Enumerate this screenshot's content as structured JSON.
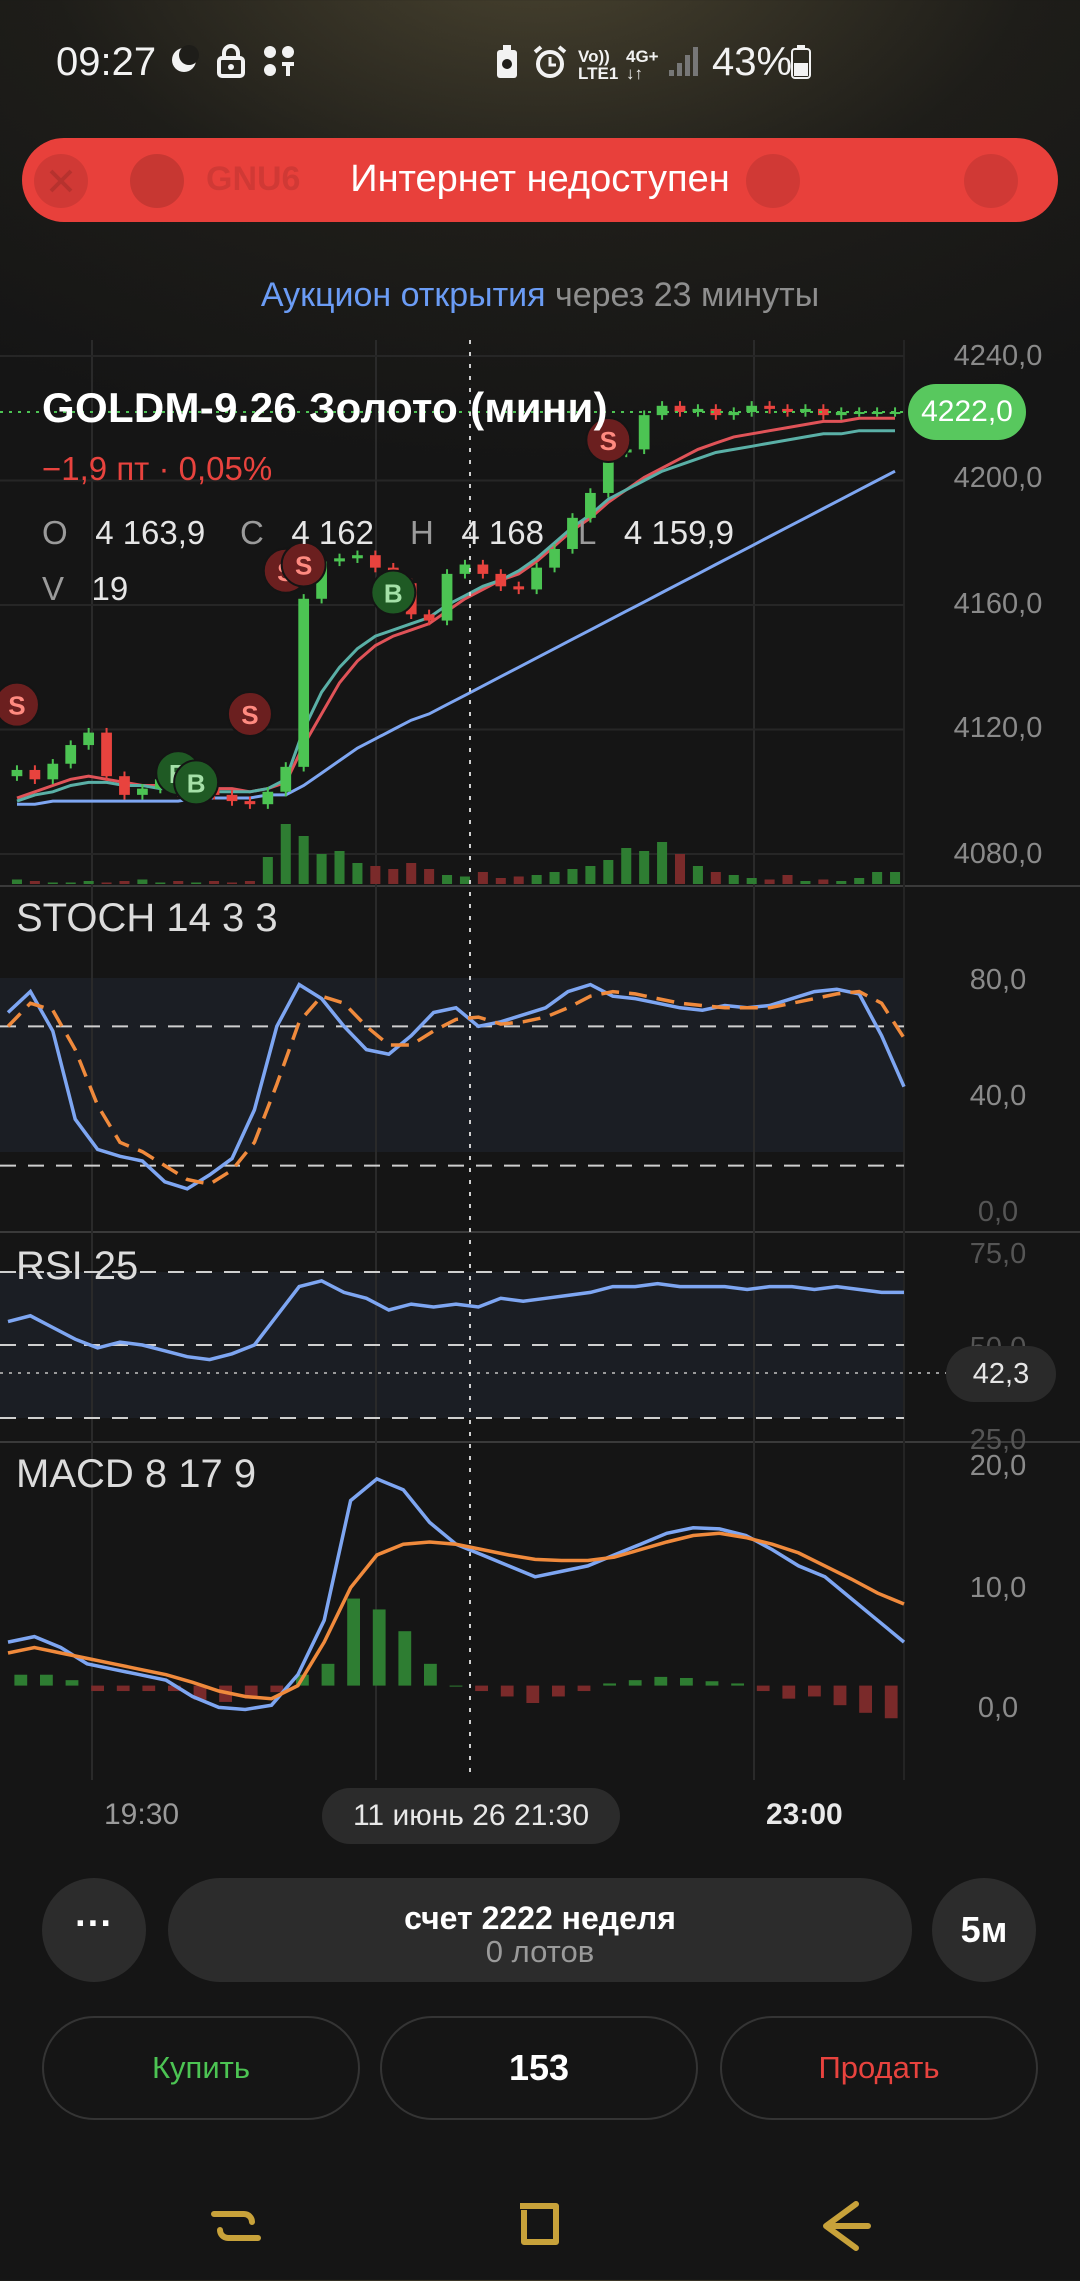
{
  "status_bar": {
    "time": "09:27",
    "battery_percent": "43%",
    "network_voice": "Vo))",
    "network_lte": "LTE1",
    "network_4g": "4G+",
    "icons": [
      "moon-icon",
      "lock-icon",
      "dots-grid-icon",
      "battery-saver-icon",
      "alarm-icon",
      "signal-icon",
      "battery-icon"
    ]
  },
  "banner": {
    "text": "Интернет недоступен",
    "ghost_ticker": "GNU6",
    "color": "#e8403b"
  },
  "auction": {
    "highlight": "Аукцион открытия",
    "rest": "через 23 минуты"
  },
  "instrument": {
    "title": "GOLDM-9.26 Золото (мини)",
    "change": "−1,9 пт · 0,05%",
    "ohlc": {
      "o_key": "O",
      "o": "4 163,9",
      "c_key": "C",
      "c": "4 162",
      "h_key": "H",
      "h": "4 168",
      "l_key": "L",
      "l": "4 159,9"
    },
    "volume": {
      "key": "V",
      "value": "19"
    },
    "last_price": "4222,0"
  },
  "axes": {
    "price": [
      "4240,0",
      "4200,0",
      "4160,0",
      "4120,0",
      "4080,0"
    ],
    "stoch": [
      "80,0",
      "40,0",
      "0,0"
    ],
    "rsi": [
      "75,0",
      "50,0",
      "25,0"
    ],
    "rsi_current": "42,3",
    "macd": [
      "20,0",
      "10,0",
      "0,0"
    ]
  },
  "panels": {
    "stoch": "STOCH 14 3 3",
    "rsi": "RSI 25",
    "macd": "MACD 8 17 9"
  },
  "time_axis": {
    "left": "19:30",
    "cursor": "11 июнь 26   21:30",
    "right": "23:00"
  },
  "markers": {
    "sell": "S",
    "buy": "B"
  },
  "controls": {
    "more": "···",
    "account_name": "счет 2222 неделя",
    "account_lots": "0 лотов",
    "timeframe": "5м",
    "buy": "Купить",
    "quantity": "153",
    "sell": "Продать"
  },
  "colors": {
    "up": "#4cc453",
    "down": "#e8433e",
    "accent": "#6b9cf5",
    "price_badge": "#58c85e"
  },
  "chart_data": [
    {
      "type": "candlestick",
      "ylim": [
        4080,
        4240
      ],
      "y_ticks": [
        4240,
        4200,
        4160,
        4120,
        4080
      ],
      "x_ticks": [
        "19:30",
        "21:30",
        "23:00"
      ],
      "close": [
        4107,
        4104,
        4109,
        4115,
        4119,
        4105,
        4099,
        4101,
        4104,
        4100,
        4101,
        4099,
        4097,
        4096,
        4100,
        4108,
        4162,
        4174,
        4175,
        4176,
        4172,
        4167,
        4157,
        4155,
        4170,
        4173,
        4170,
        4166,
        4165,
        4172,
        4178,
        4188,
        4196,
        4209,
        4210,
        4221,
        4224,
        4222,
        4223,
        4221,
        4222,
        4224,
        4223,
        4222,
        4223,
        4221,
        4222,
        4222,
        4222,
        4222
      ],
      "moving_averages": [
        {
          "color": "#e05358",
          "values": [
            4098,
            4100,
            4102,
            4104,
            4105,
            4104,
            4103,
            4102,
            4102,
            4101,
            4101,
            4101,
            4101,
            4100,
            4101,
            4103,
            4115,
            4125,
            4135,
            4142,
            4147,
            4150,
            4152,
            4154,
            4158,
            4162,
            4165,
            4168,
            4170,
            4174,
            4179,
            4184,
            4188,
            4193,
            4197,
            4201,
            4204,
            4207,
            4210,
            4212,
            4214,
            4215,
            4216,
            4217,
            4218,
            4219,
            4219,
            4220,
            4220,
            4220
          ]
        },
        {
          "color": "#5ab0a7",
          "values": [
            4097,
            4099,
            4100,
            4102,
            4103,
            4103,
            4102,
            4102,
            4101,
            4101,
            4101,
            4100,
            4100,
            4100,
            4101,
            4104,
            4120,
            4132,
            4140,
            4146,
            4150,
            4152,
            4154,
            4156,
            4160,
            4163,
            4166,
            4168,
            4171,
            4175,
            4180,
            4185,
            4189,
            4194,
            4197,
            4200,
            4203,
            4205,
            4207,
            4209,
            4210,
            4211,
            4212,
            4213,
            4214,
            4215,
            4215,
            4216,
            4216,
            4216
          ]
        },
        {
          "color": "#7ea6f2",
          "values": [
            4096,
            4096,
            4097,
            4097,
            4097,
            4097,
            4097,
            4097,
            4097,
            4097,
            4098,
            4098,
            4098,
            4098,
            4099,
            4099,
            4102,
            4106,
            4110,
            4114,
            4117,
            4120,
            4123,
            4125,
            4128,
            4131,
            4134,
            4137,
            4140,
            4143,
            4146,
            4149,
            4152,
            4155,
            4158,
            4161,
            4164,
            4167,
            4170,
            4173,
            4176,
            4179,
            4182,
            4185,
            4188,
            4191,
            4194,
            4197,
            4200,
            4203
          ]
        }
      ],
      "volume": [
        3,
        2,
        1,
        1,
        2,
        1,
        2,
        3,
        1,
        2,
        1,
        2,
        1,
        2,
        18,
        40,
        32,
        20,
        22,
        14,
        12,
        10,
        14,
        10,
        6,
        5,
        8,
        4,
        5,
        6,
        8,
        10,
        12,
        16,
        24,
        22,
        28,
        20,
        12,
        8,
        6,
        4,
        3,
        6,
        2,
        3,
        2,
        4,
        8,
        8
      ],
      "signals": [
        {
          "x": 0,
          "y": 4128,
          "type": "S"
        },
        {
          "x": 13,
          "y": 4125,
          "type": "S"
        },
        {
          "x": 15,
          "y": 4171,
          "type": "S"
        },
        {
          "x": 16,
          "y": 4173,
          "type": "S"
        },
        {
          "x": 21,
          "y": 4164,
          "type": "B"
        },
        {
          "x": 9,
          "y": 4106,
          "type": "B"
        },
        {
          "x": 10,
          "y": 4103,
          "type": "B"
        },
        {
          "x": 33,
          "y": 4213,
          "type": "S"
        }
      ]
    },
    {
      "type": "line",
      "title": "STOCH 14 3 3",
      "ylim": [
        0,
        100
      ],
      "levels": [
        80,
        20
      ],
      "series": [
        {
          "color": "#7ea6f2",
          "values": [
            86,
            95,
            78,
            40,
            27,
            24,
            22,
            13,
            10,
            16,
            23,
            44,
            80,
            98,
            92,
            80,
            70,
            68,
            76,
            86,
            88,
            80,
            82,
            85,
            88,
            95,
            98,
            93,
            92,
            90,
            88,
            87,
            89,
            88,
            89,
            92,
            95,
            96,
            94,
            76,
            54
          ]
        },
        {
          "color": "#f08a3c",
          "values": [
            80,
            90,
            87,
            70,
            46,
            30,
            26,
            20,
            14,
            12,
            18,
            30,
            55,
            82,
            93,
            90,
            80,
            72,
            72,
            78,
            83,
            84,
            81,
            82,
            84,
            88,
            93,
            95,
            94,
            92,
            90,
            89,
            88,
            88,
            88,
            90,
            92,
            94,
            95,
            90,
            75
          ]
        }
      ]
    },
    {
      "type": "line",
      "title": "RSI 25",
      "ylim": [
        25,
        75
      ],
      "levels": [
        75,
        50,
        25
      ],
      "series": [
        {
          "color": "#7ea6f2",
          "values": [
            58,
            60,
            56,
            52,
            49,
            51,
            50,
            48,
            46,
            45,
            47,
            50,
            60,
            70,
            72,
            68,
            66,
            62,
            64,
            63,
            64,
            63,
            66,
            65,
            66,
            67,
            68,
            70,
            70,
            71,
            70,
            70,
            70,
            69,
            70,
            70,
            69,
            70,
            69,
            68,
            68
          ]
        }
      ]
    },
    {
      "type": "line",
      "title": "MACD 8 17 9",
      "ylim": [
        -5,
        20
      ],
      "series": [
        {
          "color": "#7ea6f2",
          "values": [
            4,
            4.5,
            3.5,
            2,
            1.5,
            1,
            0.5,
            -1,
            -2,
            -2.2,
            -1.8,
            1,
            6,
            17,
            19,
            18,
            15,
            13,
            12,
            11,
            10,
            10.5,
            11,
            12,
            13,
            14,
            14.5,
            14.4,
            13.8,
            12.5,
            11,
            10,
            8,
            6,
            4
          ]
        },
        {
          "color": "#f08a3c",
          "values": [
            3,
            3.5,
            3,
            2.5,
            2,
            1.5,
            1,
            0.3,
            -0.5,
            -1,
            -1.2,
            0,
            4,
            9,
            12,
            13,
            13.2,
            13,
            12.5,
            12,
            11.6,
            11.5,
            11.5,
            11.8,
            12.5,
            13.2,
            13.8,
            14,
            13.6,
            13,
            12.2,
            11,
            9.8,
            8.5,
            7.5
          ]
        }
      ],
      "histogram": [
        1,
        1,
        0.5,
        -0.5,
        -0.5,
        -0.5,
        -0.5,
        -1.3,
        -1.5,
        -1.2,
        -0.6,
        1,
        2,
        8,
        7,
        5,
        2,
        0,
        -0.5,
        -1,
        -1.6,
        -1,
        -0.5,
        0.2,
        0.5,
        0.8,
        0.7,
        0.4,
        0.2,
        -0.5,
        -1.2,
        -1,
        -1.8,
        -2.5,
        -3
      ]
    }
  ]
}
